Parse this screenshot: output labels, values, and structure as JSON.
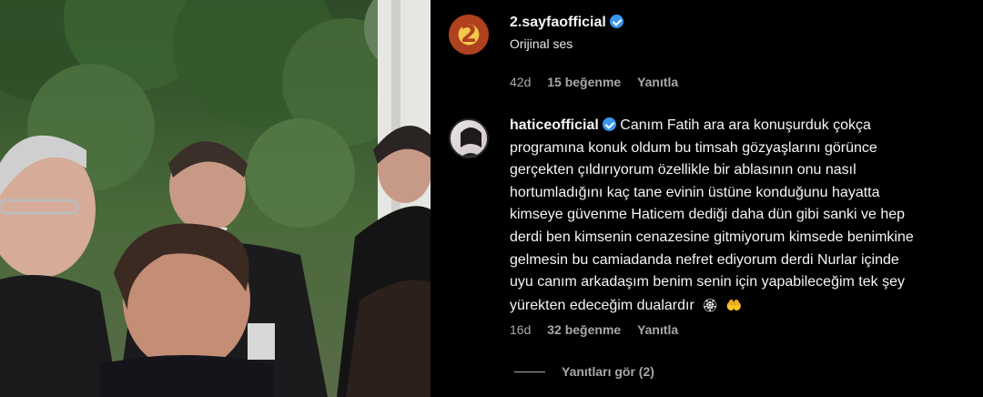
{
  "comments": [
    {
      "username": "2.sayfaofficial",
      "verified": true,
      "avatar_label": "2",
      "text": "Orijinal ses",
      "age": "42d",
      "likes": "15 beğenme",
      "reply": "Yanıtla"
    },
    {
      "username": "haticeofficial",
      "verified": true,
      "lines": [
        "Canım Fatih ara ara konuşurduk çokça",
        "programına konuk oldum bu timsah gözyaşlarını görünce",
        "gerçekten çıldırıyorum özellikle bir ablasının onu nasıl",
        "hortumladığını kaç tane evinin üstüne konduğunu hayatta",
        "kimseye güvenme Haticem dediği daha dün gibi sanki ve hep",
        "derdi ben kimsenin cenazesine gitmiyorum kimsede benimkine",
        "gelmesin bu camiadanda nefret ediyorum derdi Nurlar içinde",
        "uyu canım arkadaşım benim senin için yapabileceğim tek şey",
        "yürekten edeceğim dualardır"
      ],
      "emojis": [
        "🏵",
        "🤲"
      ],
      "age": "16d",
      "likes": "32 beğenme",
      "reply": "Yanıtla"
    }
  ],
  "view_replies": "Yanıtları gör (2)",
  "colors": {
    "background": "#000000",
    "text": "#f5f5f5",
    "secondary_text": "#a8a8a8",
    "verified_badge": "#3897f0"
  }
}
